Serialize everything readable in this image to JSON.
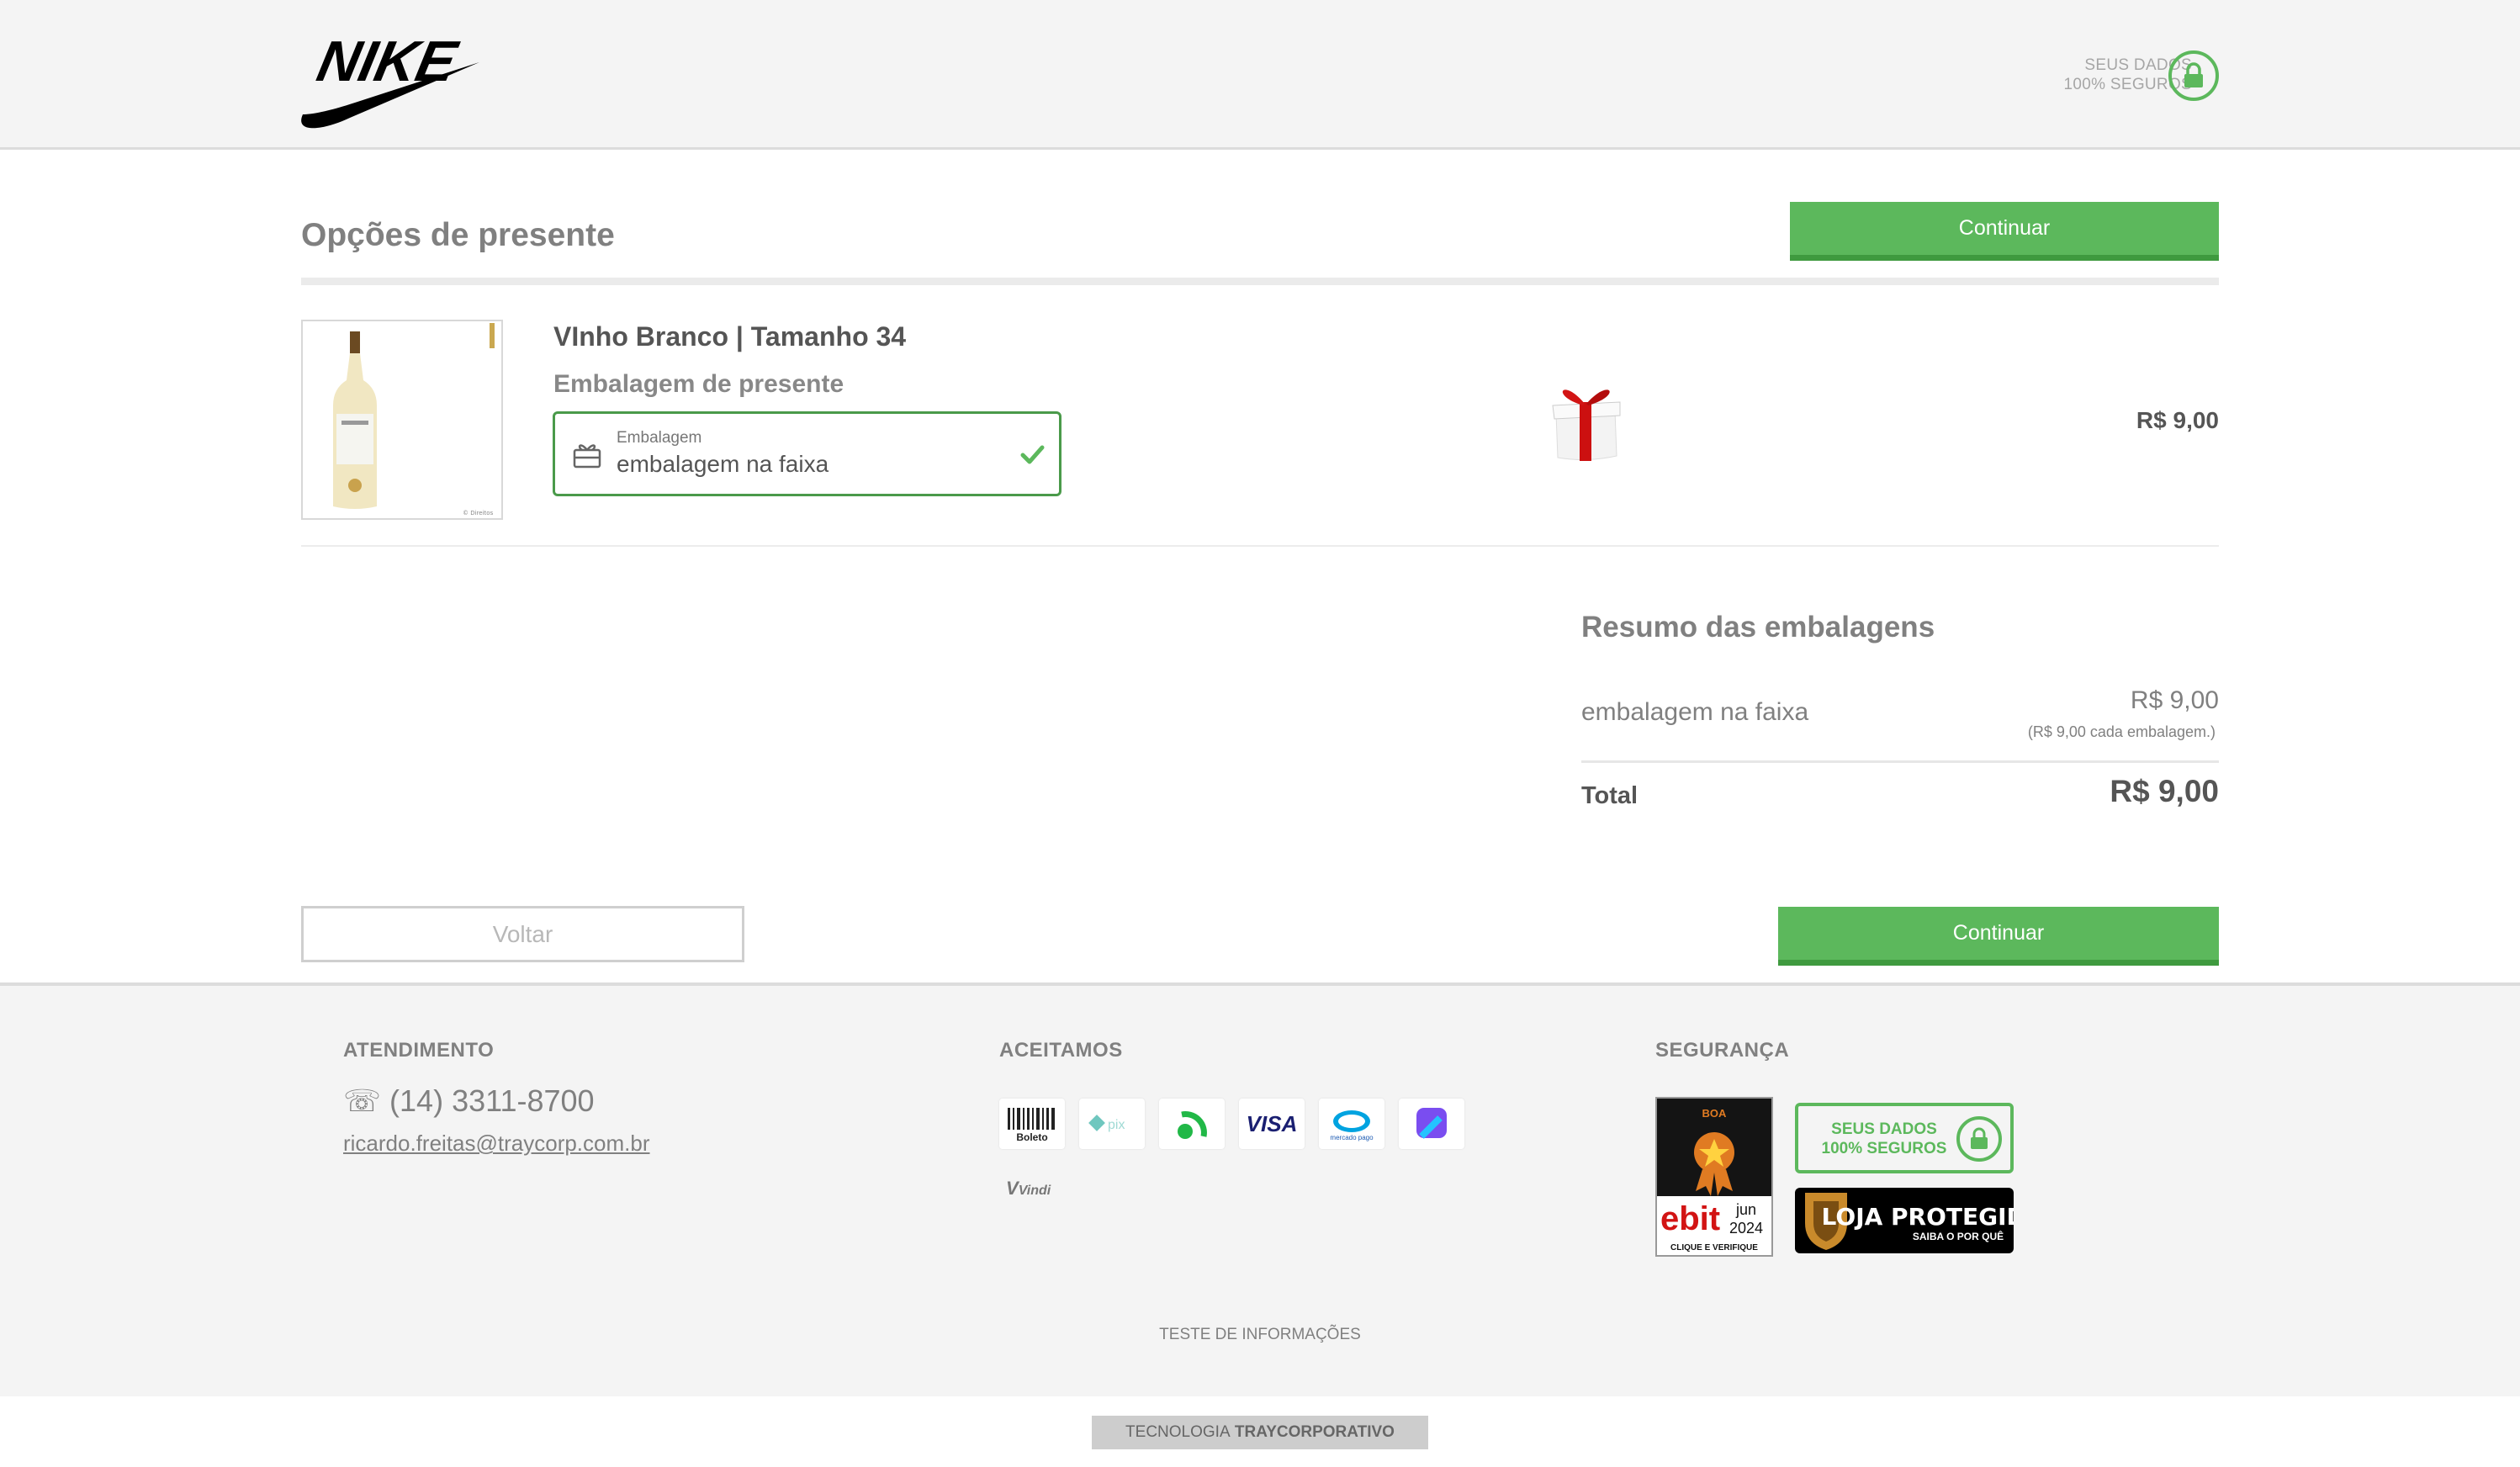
{
  "header": {
    "brand": "NIKE",
    "secure_line1": "SEUS DADOS",
    "secure_line2": "100% SEGUROS"
  },
  "main": {
    "title": "Opções de presente",
    "continue_label": "Continuar",
    "product": {
      "name": "VInho Branco | Tamanho 34",
      "wrap_label": "Embalagem de presente",
      "select_caption": "Embalagem",
      "select_value": "embalagem na faixa",
      "price": "R$ 9,00"
    },
    "summary": {
      "title": "Resumo das embalagens",
      "item_label": "embalagem na faixa",
      "item_price": "R$ 9,00",
      "item_note": "(R$ 9,00 cada embalagem.)",
      "total_label": "Total",
      "total_value": "R$ 9,00"
    },
    "back_label": "Voltar"
  },
  "footer": {
    "atendimento_title": "ATENDIMENTO",
    "phone": "(14) 3311-8700",
    "email": "ricardo.freitas@traycorp.com.br",
    "aceitamos_title": "ACEITAMOS",
    "payment_methods": [
      "Boleto",
      "pix",
      "PicPay",
      "VISA",
      "mercado pago",
      "Pagaleve"
    ],
    "vindi": "Vindi",
    "seguranca_title": "SEGURANÇA",
    "ebit_top": "BOA",
    "ebit_brand": "ebit",
    "ebit_month": "jun",
    "ebit_year": "2024",
    "ebit_cta": "CLIQUE E VERIFIQUE",
    "badge_line1": "SEUS DADOS",
    "badge_line2": "100% SEGUROS",
    "loja_title": "LOJA PROTEGIDA",
    "loja_sub": "SAIBA O POR QUÊ",
    "teste": "TESTE DE INFORMAÇÕES",
    "tech_prefix": "TECNOLOGIA",
    "tech_brand": "TRAYCORPORATIVO"
  },
  "colors": {
    "accent": "#5cb85c",
    "accent_dark": "#3f9a3f",
    "text": "#555555",
    "muted": "#808080"
  },
  "icons": [
    "lock-icon",
    "gift-box-icon",
    "check-icon",
    "phone-icon",
    "gift-icon"
  ]
}
